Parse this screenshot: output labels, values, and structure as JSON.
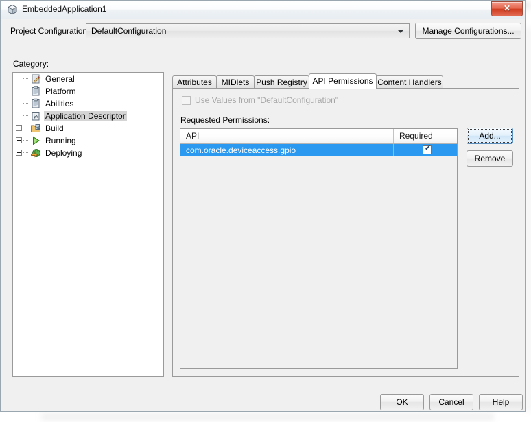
{
  "window": {
    "title": "EmbeddedApplication1",
    "title_icon": "cube-icon",
    "close_label": "✕"
  },
  "config": {
    "label": "Project Configuration:",
    "selected": "DefaultConfiguration",
    "options": [
      "DefaultConfiguration"
    ],
    "manage_label": "Manage Configurations..."
  },
  "category": {
    "label": "Category:",
    "items": [
      {
        "label": "General",
        "icon": "note-pencil-icon",
        "expandable": false,
        "selected": false
      },
      {
        "label": "Platform",
        "icon": "clipboard-icon",
        "expandable": false,
        "selected": false
      },
      {
        "label": "Abilities",
        "icon": "clipboard-icon",
        "expandable": false,
        "selected": false
      },
      {
        "label": "Application Descriptor",
        "icon": "descriptor-icon",
        "expandable": false,
        "selected": true
      },
      {
        "label": "Build",
        "icon": "build-folder-icon",
        "expandable": true,
        "selected": false
      },
      {
        "label": "Running",
        "icon": "play-icon",
        "expandable": true,
        "selected": false
      },
      {
        "label": "Deploying",
        "icon": "deploy-globe-icon",
        "expandable": true,
        "selected": false
      }
    ]
  },
  "tabs": [
    {
      "label": "Attributes",
      "active": false
    },
    {
      "label": "MIDlets",
      "active": false
    },
    {
      "label": "Push Registry",
      "active": false
    },
    {
      "label": "API Permissions",
      "active": true
    },
    {
      "label": "Content Handlers",
      "active": false
    }
  ],
  "panel": {
    "use_values_label": "Use Values from \"DefaultConfiguration\"",
    "use_values_checked": false,
    "use_values_enabled": false,
    "requested_label": "Requested Permissions:",
    "table": {
      "columns": [
        "API",
        "Required"
      ],
      "rows": [
        {
          "api": "com.oracle.deviceaccess.gpio",
          "required": true,
          "required_mark": "✔",
          "selected": true
        }
      ]
    },
    "add_label": "Add...",
    "remove_label": "Remove"
  },
  "footer": {
    "ok_label": "OK",
    "cancel_label": "Cancel",
    "help_label": "Help"
  },
  "colors": {
    "selection_blue": "#2a99ef",
    "tree_selection_grey": "#d4d4d4",
    "dialog_background": "#f0f0f0",
    "close_red": "#cf3c20"
  }
}
